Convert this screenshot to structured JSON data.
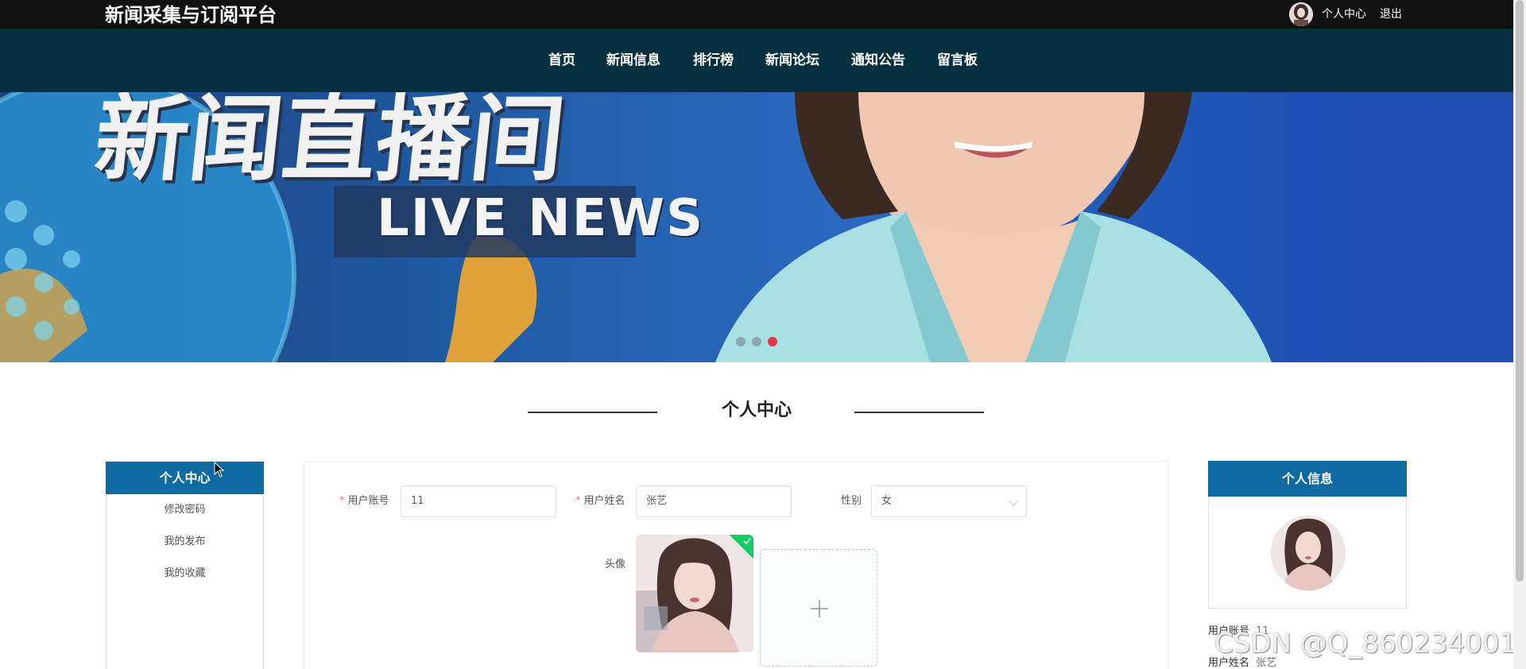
{
  "header": {
    "site_title": "新闻采集与订阅平台",
    "user_center": "个人中心",
    "logout": "退出"
  },
  "nav": {
    "items": [
      "首页",
      "新闻信息",
      "排行榜",
      "新闻论坛",
      "通知公告",
      "留言板"
    ],
    "background": "#06303f"
  },
  "banner": {
    "headline_cn": "新闻直播间",
    "headline_en": "LIVE NEWS",
    "slide_count": 3,
    "active_slide": 3
  },
  "section": {
    "title": "个人中心"
  },
  "left_menu": {
    "header": "个人中心",
    "items": [
      "修改密码",
      "我的发布",
      "我的收藏"
    ],
    "accent": "#0e6aa1"
  },
  "form": {
    "account_label": "用户账号",
    "account_value": "11",
    "name_label": "用户姓名",
    "name_value": "张艺",
    "gender_label": "性别",
    "gender_value": "女",
    "avatar_label": "头像"
  },
  "info_card": {
    "header": "个人信息",
    "account_label": "用户账号",
    "account_value": "11",
    "name_label": "用户姓名",
    "name_value": "张艺"
  },
  "watermark": "CSDN @Q_860234001",
  "icons": {
    "cursor": "mouse-cursor-icon",
    "plus": "plus-icon",
    "check": "check-icon",
    "select": "chevron-down-icon"
  }
}
